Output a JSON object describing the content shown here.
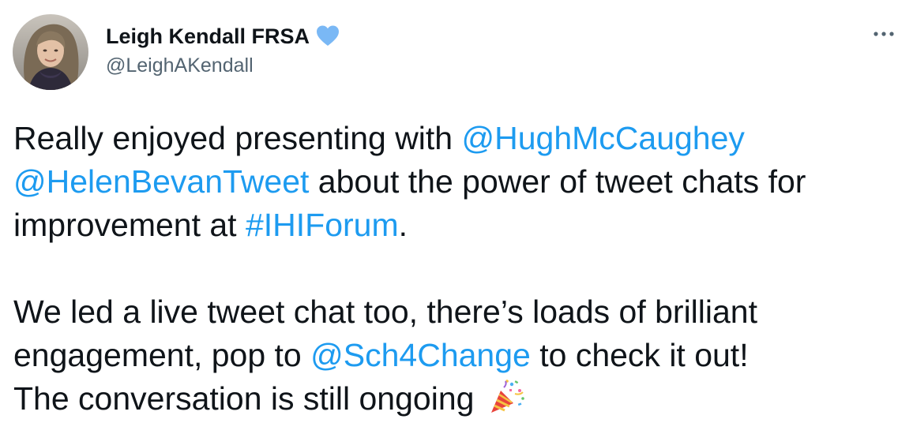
{
  "tweet": {
    "author": {
      "display_name": "Leigh Kendall FRSA",
      "handle": "@LeighAKendall",
      "verified_icon": "verified-badge-icon",
      "verified_color": "#7ab8f5",
      "avatar_icon": "avatar-photo"
    },
    "more_icon": "more-options-icon",
    "link_color": "#1d9bf0",
    "text": {
      "p1_t1": "Really enjoyed presenting with ",
      "p1_m1": "@HughMcCaughey",
      "p1_t2": " ",
      "p1_m2": "@HelenBevanTweet",
      "p1_t3": " about the power of tweet chats for improvement at ",
      "p1_h1": "#IHIForum",
      "p1_t4": ".",
      "p2_t1": "We led a live tweet chat too, there’s loads of brilliant engagement, pop to ",
      "p2_m1": "@Sch4Change",
      "p2_t2": " to check it out!",
      "p3_t1": "The conversation is still ongoing ",
      "p3_emoji": "party-popper-icon"
    }
  }
}
